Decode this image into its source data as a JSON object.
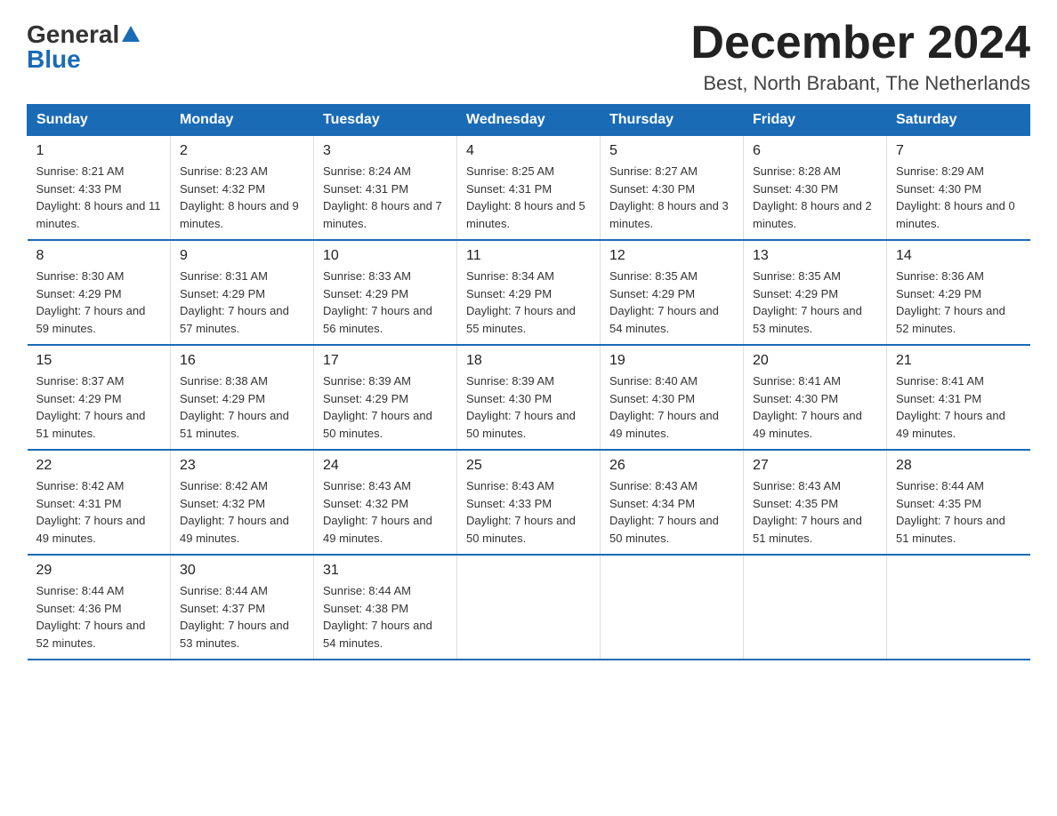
{
  "logo": {
    "general": "General",
    "blue": "Blue"
  },
  "title": "December 2024",
  "subtitle": "Best, North Brabant, The Netherlands",
  "weekdays": [
    "Sunday",
    "Monday",
    "Tuesday",
    "Wednesday",
    "Thursday",
    "Friday",
    "Saturday"
  ],
  "weeks": [
    [
      {
        "day": "1",
        "sunrise": "8:21 AM",
        "sunset": "4:33 PM",
        "daylight": "8 hours and 11 minutes."
      },
      {
        "day": "2",
        "sunrise": "8:23 AM",
        "sunset": "4:32 PM",
        "daylight": "8 hours and 9 minutes."
      },
      {
        "day": "3",
        "sunrise": "8:24 AM",
        "sunset": "4:31 PM",
        "daylight": "8 hours and 7 minutes."
      },
      {
        "day": "4",
        "sunrise": "8:25 AM",
        "sunset": "4:31 PM",
        "daylight": "8 hours and 5 minutes."
      },
      {
        "day": "5",
        "sunrise": "8:27 AM",
        "sunset": "4:30 PM",
        "daylight": "8 hours and 3 minutes."
      },
      {
        "day": "6",
        "sunrise": "8:28 AM",
        "sunset": "4:30 PM",
        "daylight": "8 hours and 2 minutes."
      },
      {
        "day": "7",
        "sunrise": "8:29 AM",
        "sunset": "4:30 PM",
        "daylight": "8 hours and 0 minutes."
      }
    ],
    [
      {
        "day": "8",
        "sunrise": "8:30 AM",
        "sunset": "4:29 PM",
        "daylight": "7 hours and 59 minutes."
      },
      {
        "day": "9",
        "sunrise": "8:31 AM",
        "sunset": "4:29 PM",
        "daylight": "7 hours and 57 minutes."
      },
      {
        "day": "10",
        "sunrise": "8:33 AM",
        "sunset": "4:29 PM",
        "daylight": "7 hours and 56 minutes."
      },
      {
        "day": "11",
        "sunrise": "8:34 AM",
        "sunset": "4:29 PM",
        "daylight": "7 hours and 55 minutes."
      },
      {
        "day": "12",
        "sunrise": "8:35 AM",
        "sunset": "4:29 PM",
        "daylight": "7 hours and 54 minutes."
      },
      {
        "day": "13",
        "sunrise": "8:35 AM",
        "sunset": "4:29 PM",
        "daylight": "7 hours and 53 minutes."
      },
      {
        "day": "14",
        "sunrise": "8:36 AM",
        "sunset": "4:29 PM",
        "daylight": "7 hours and 52 minutes."
      }
    ],
    [
      {
        "day": "15",
        "sunrise": "8:37 AM",
        "sunset": "4:29 PM",
        "daylight": "7 hours and 51 minutes."
      },
      {
        "day": "16",
        "sunrise": "8:38 AM",
        "sunset": "4:29 PM",
        "daylight": "7 hours and 51 minutes."
      },
      {
        "day": "17",
        "sunrise": "8:39 AM",
        "sunset": "4:29 PM",
        "daylight": "7 hours and 50 minutes."
      },
      {
        "day": "18",
        "sunrise": "8:39 AM",
        "sunset": "4:30 PM",
        "daylight": "7 hours and 50 minutes."
      },
      {
        "day": "19",
        "sunrise": "8:40 AM",
        "sunset": "4:30 PM",
        "daylight": "7 hours and 49 minutes."
      },
      {
        "day": "20",
        "sunrise": "8:41 AM",
        "sunset": "4:30 PM",
        "daylight": "7 hours and 49 minutes."
      },
      {
        "day": "21",
        "sunrise": "8:41 AM",
        "sunset": "4:31 PM",
        "daylight": "7 hours and 49 minutes."
      }
    ],
    [
      {
        "day": "22",
        "sunrise": "8:42 AM",
        "sunset": "4:31 PM",
        "daylight": "7 hours and 49 minutes."
      },
      {
        "day": "23",
        "sunrise": "8:42 AM",
        "sunset": "4:32 PM",
        "daylight": "7 hours and 49 minutes."
      },
      {
        "day": "24",
        "sunrise": "8:43 AM",
        "sunset": "4:32 PM",
        "daylight": "7 hours and 49 minutes."
      },
      {
        "day": "25",
        "sunrise": "8:43 AM",
        "sunset": "4:33 PM",
        "daylight": "7 hours and 50 minutes."
      },
      {
        "day": "26",
        "sunrise": "8:43 AM",
        "sunset": "4:34 PM",
        "daylight": "7 hours and 50 minutes."
      },
      {
        "day": "27",
        "sunrise": "8:43 AM",
        "sunset": "4:35 PM",
        "daylight": "7 hours and 51 minutes."
      },
      {
        "day": "28",
        "sunrise": "8:44 AM",
        "sunset": "4:35 PM",
        "daylight": "7 hours and 51 minutes."
      }
    ],
    [
      {
        "day": "29",
        "sunrise": "8:44 AM",
        "sunset": "4:36 PM",
        "daylight": "7 hours and 52 minutes."
      },
      {
        "day": "30",
        "sunrise": "8:44 AM",
        "sunset": "4:37 PM",
        "daylight": "7 hours and 53 minutes."
      },
      {
        "day": "31",
        "sunrise": "8:44 AM",
        "sunset": "4:38 PM",
        "daylight": "7 hours and 54 minutes."
      },
      null,
      null,
      null,
      null
    ]
  ]
}
